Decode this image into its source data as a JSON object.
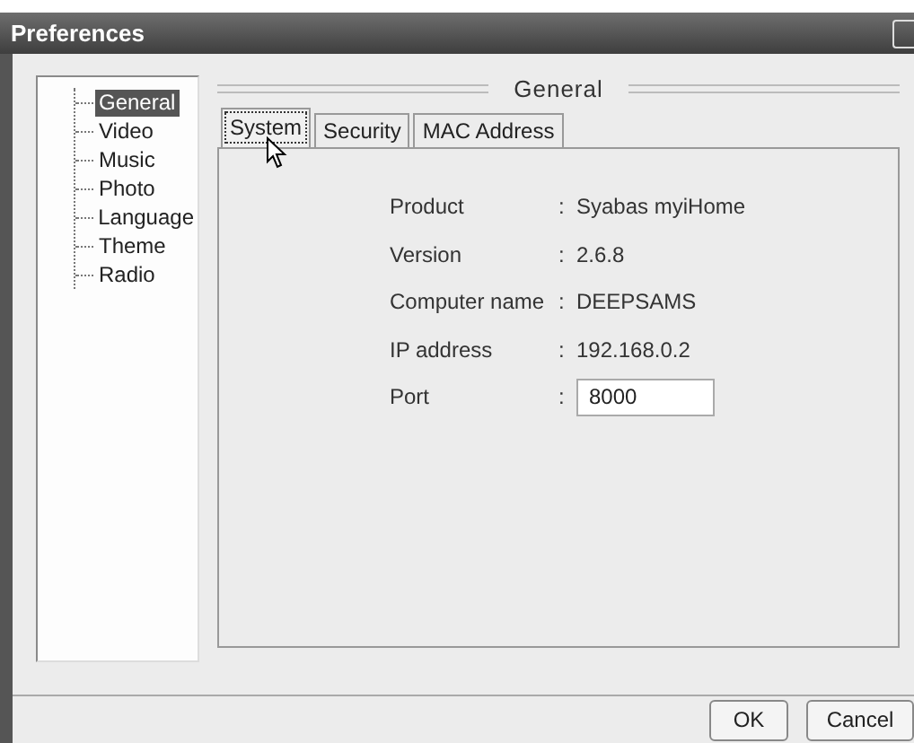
{
  "window": {
    "title": "Preferences"
  },
  "sidebar": {
    "items": [
      {
        "label": "General",
        "selected": true
      },
      {
        "label": "Video",
        "selected": false
      },
      {
        "label": "Music",
        "selected": false
      },
      {
        "label": "Photo",
        "selected": false
      },
      {
        "label": "Language",
        "selected": false
      },
      {
        "label": "Theme",
        "selected": false
      },
      {
        "label": "Radio",
        "selected": false
      }
    ]
  },
  "section": {
    "title": "General"
  },
  "tabs": [
    {
      "label": "System",
      "selected": true
    },
    {
      "label": "Security",
      "selected": false
    },
    {
      "label": "MAC Address",
      "selected": false
    }
  ],
  "fields": [
    {
      "kind": "text",
      "label": "Product",
      "separator": ":",
      "value": "Syabas myiHome"
    },
    {
      "kind": "text",
      "label": "Version",
      "separator": ":",
      "value": "2.6.8"
    },
    {
      "kind": "text",
      "label": "Computer name",
      "separator": ":",
      "value": "DEEPSAMS"
    },
    {
      "kind": "text",
      "label": "IP address",
      "separator": ":",
      "value": "192.168.0.2"
    },
    {
      "kind": "input",
      "label": "Port",
      "separator": ":",
      "value": "8000"
    }
  ],
  "buttons": [
    "OK",
    "Cancel"
  ]
}
